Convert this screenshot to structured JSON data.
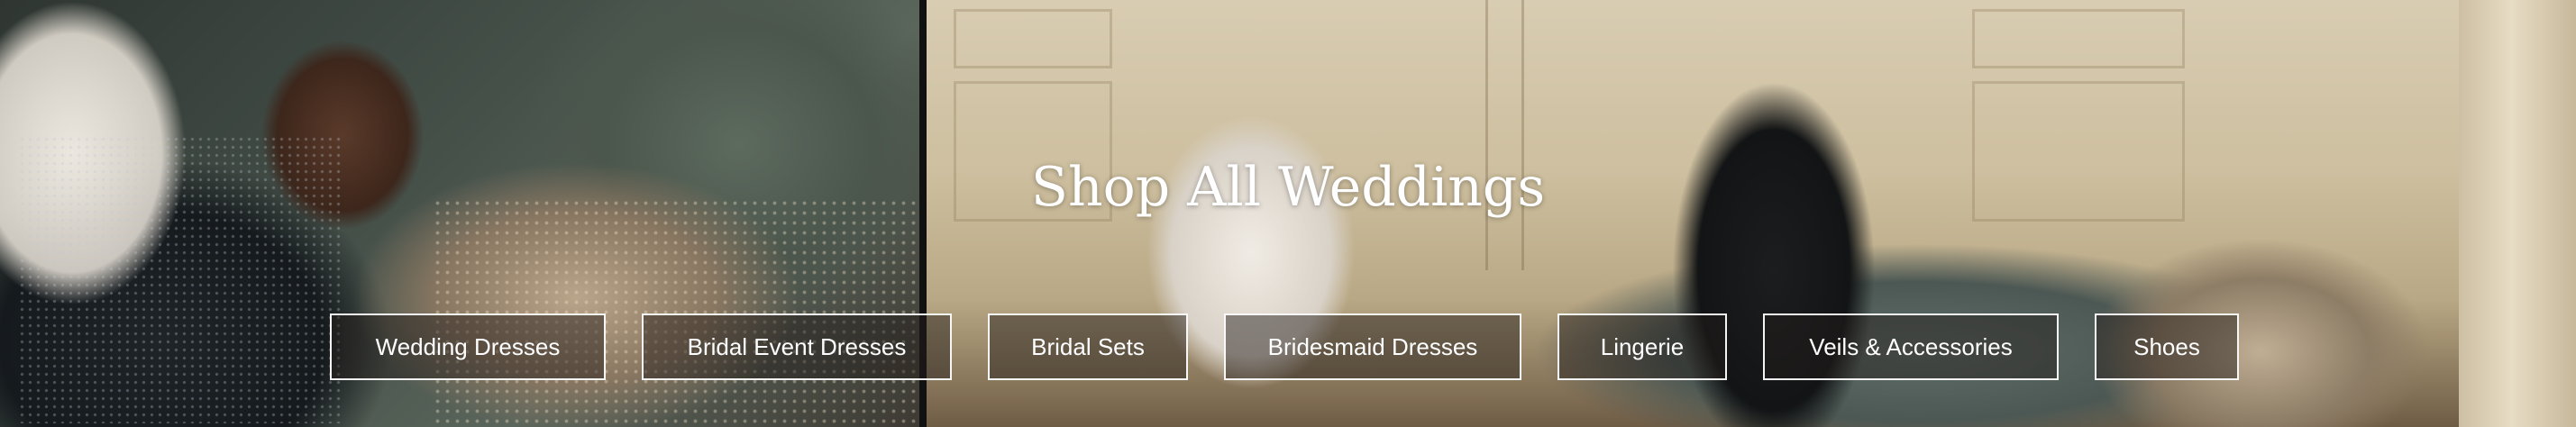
{
  "hero": {
    "heading": "Shop All Weddings",
    "buttons": [
      {
        "label": "Wedding Dresses"
      },
      {
        "label": "Bridal Event Dresses"
      },
      {
        "label": "Bridal Sets"
      },
      {
        "label": "Bridesmaid Dresses"
      },
      {
        "label": "Lingerie"
      },
      {
        "label": "Veils & Accessories"
      },
      {
        "label": "Shoes"
      }
    ]
  },
  "colors": {
    "heading_text": "#ffffff",
    "button_border": "#ffffff",
    "button_fill": "rgba(35,30,28,0.48)"
  }
}
